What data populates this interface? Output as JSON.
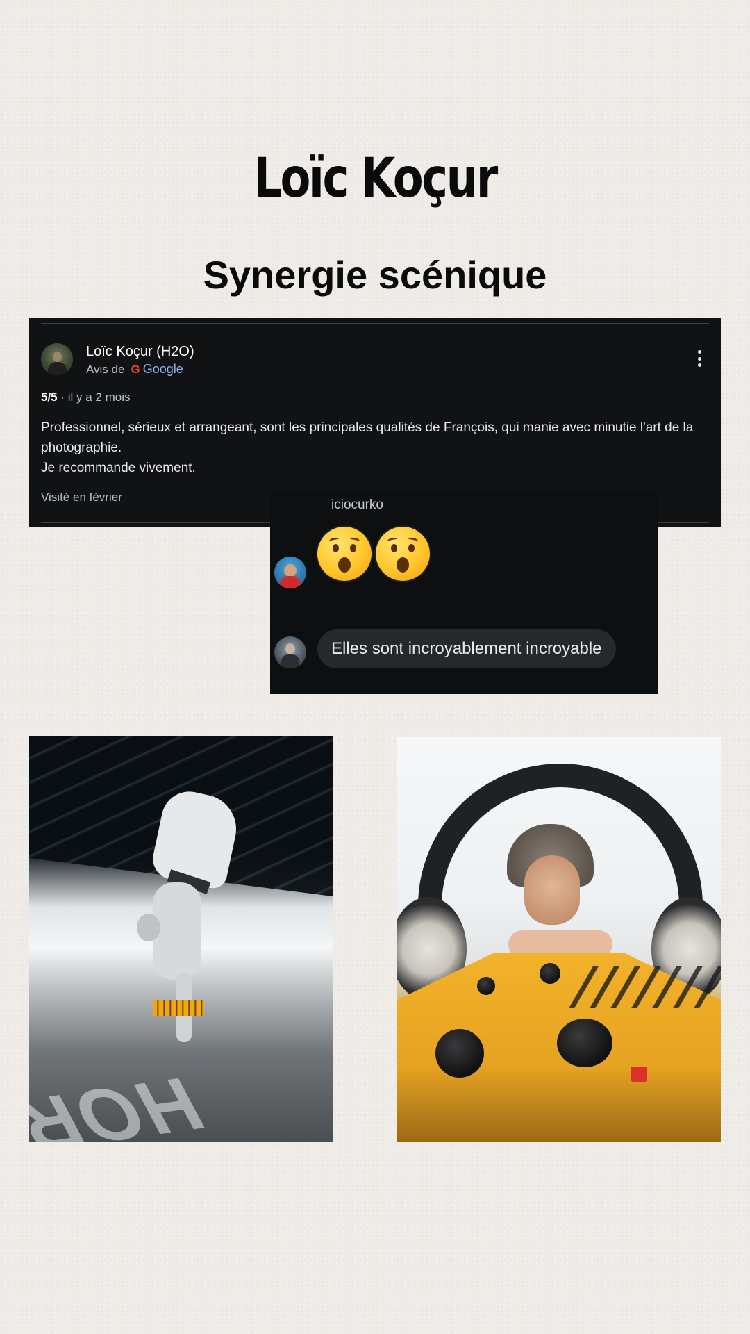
{
  "header": {
    "title": "Loïc Koçur",
    "subtitle": "Synergie scénique"
  },
  "review": {
    "reviewer_name": "Loïc Koçur (H2O)",
    "source_prefix": "Avis de",
    "source_brand": "Google",
    "rating": "5/5",
    "age": " · il y a 2 mois",
    "text_line1": "Professionnel, sérieux et arrangeant, sont les principales qualités de François, qui manie avec minutie l'art de la photographie.",
    "text_line2": "Je recommande vivement.",
    "visited": "Visité en février",
    "menu_icon": "kebab-menu-icon"
  },
  "chat": {
    "username": "iciocurko",
    "reactions": [
      "astonished-face-emoji",
      "astonished-face-emoji"
    ],
    "message": "Elles sont incroyablement incroyable"
  },
  "photos": {
    "left": "breakdancer-photo",
    "right": "producer-photo",
    "floor_text": "ЯOH"
  }
}
